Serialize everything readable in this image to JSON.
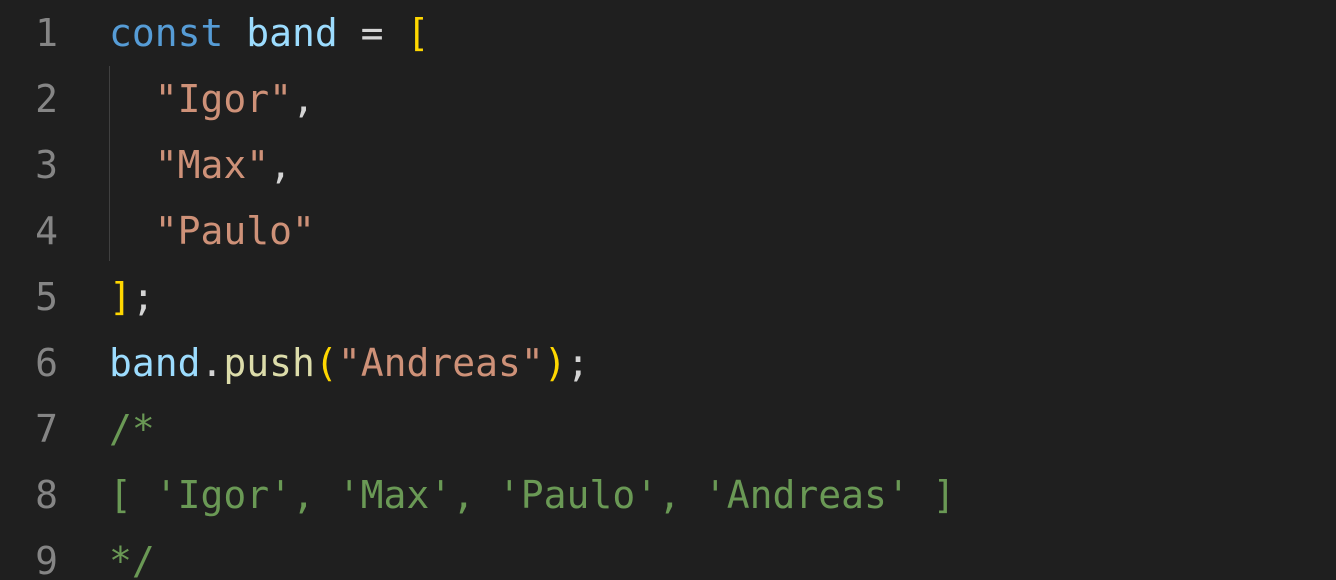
{
  "editor": {
    "language": "javascript",
    "lines": [
      {
        "number": "1",
        "tokens": [
          {
            "text": "const",
            "type": "keyword"
          },
          {
            "text": " ",
            "type": "space"
          },
          {
            "text": "band",
            "type": "variable"
          },
          {
            "text": " = ",
            "type": "operator"
          },
          {
            "text": "[",
            "type": "bracket"
          }
        ]
      },
      {
        "number": "2",
        "tokens": [
          {
            "text": "  ",
            "type": "space"
          },
          {
            "text": "\"Igor\"",
            "type": "string"
          },
          {
            "text": ",",
            "type": "operator"
          }
        ]
      },
      {
        "number": "3",
        "tokens": [
          {
            "text": "  ",
            "type": "space"
          },
          {
            "text": "\"Max\"",
            "type": "string"
          },
          {
            "text": ",",
            "type": "operator"
          }
        ]
      },
      {
        "number": "4",
        "tokens": [
          {
            "text": "  ",
            "type": "space"
          },
          {
            "text": "\"Paulo\"",
            "type": "string"
          }
        ]
      },
      {
        "number": "5",
        "tokens": [
          {
            "text": "]",
            "type": "bracket"
          },
          {
            "text": ";",
            "type": "operator"
          }
        ]
      },
      {
        "number": "6",
        "tokens": [
          {
            "text": "band",
            "type": "variable"
          },
          {
            "text": ".",
            "type": "operator"
          },
          {
            "text": "push",
            "type": "function"
          },
          {
            "text": "(",
            "type": "bracket"
          },
          {
            "text": "\"Andreas\"",
            "type": "string"
          },
          {
            "text": ")",
            "type": "bracket"
          },
          {
            "text": ";",
            "type": "operator"
          }
        ]
      },
      {
        "number": "7",
        "tokens": [
          {
            "text": "/*",
            "type": "comment"
          }
        ]
      },
      {
        "number": "8",
        "tokens": [
          {
            "text": "[ 'Igor', 'Max', 'Paulo', 'Andreas' ]",
            "type": "comment"
          }
        ]
      },
      {
        "number": "9",
        "tokens": [
          {
            "text": "*/",
            "type": "comment"
          }
        ]
      }
    ],
    "colors": {
      "background": "#1f1f1f",
      "line_number": "#858585",
      "keyword": "#569cd6",
      "variable": "#9cdcfe",
      "operator": "#d4d4d4",
      "bracket": "#ffd700",
      "string": "#ce9178",
      "function": "#dcdcaa",
      "comment": "#6a9955"
    }
  }
}
